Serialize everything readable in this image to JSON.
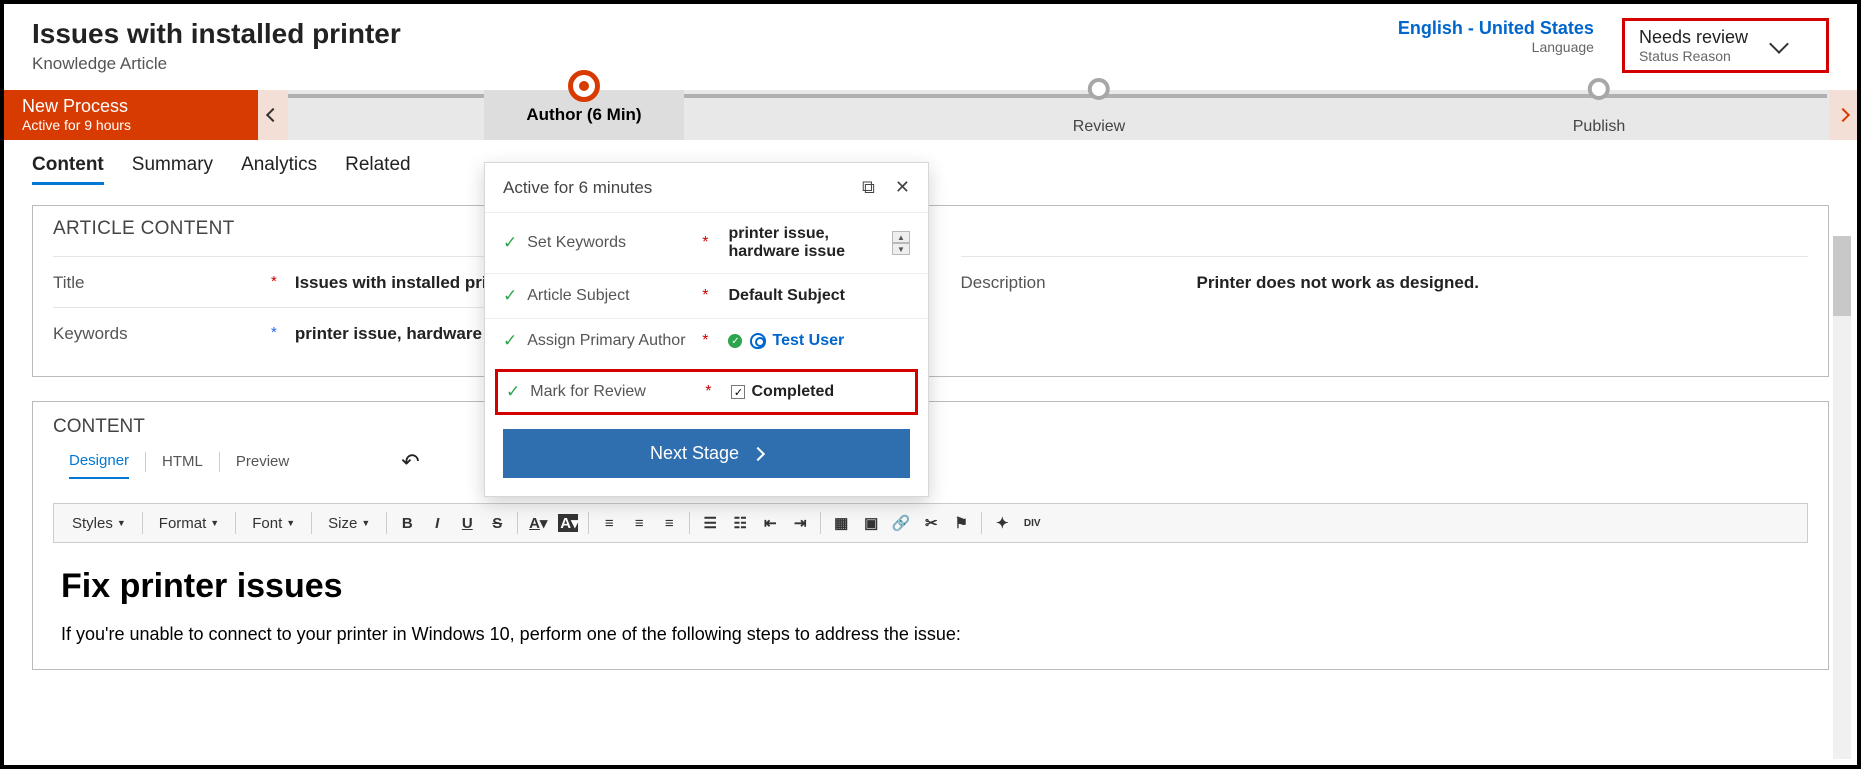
{
  "header": {
    "title": "Issues with installed printer",
    "subtitle": "Knowledge Article",
    "language": "English - United States",
    "language_label": "Language",
    "status": "Needs review",
    "status_label": "Status Reason"
  },
  "process": {
    "name": "New Process",
    "active": "Active for 9 hours",
    "stages": {
      "author": "Author  (6 Min)",
      "review": "Review",
      "publish": "Publish"
    }
  },
  "tabs": [
    "Content",
    "Summary",
    "Analytics",
    "Related"
  ],
  "article_panel": {
    "heading": "ARTICLE CONTENT",
    "fields": {
      "title_label": "Title",
      "title_value": "Issues with installed printer",
      "description_label": "Description",
      "description_value": "Printer does not work as designed.",
      "keywords_label": "Keywords",
      "keywords_value": "printer issue, hardware issue"
    }
  },
  "content_section": {
    "heading": "CONTENT",
    "tabs": {
      "designer": "Designer",
      "html": "HTML",
      "preview": "Preview"
    },
    "toolbar": {
      "styles": "Styles",
      "format": "Format",
      "font": "Font",
      "size": "Size"
    },
    "body_h": "Fix printer issues",
    "body_p": "If you're unable to connect to your printer in Windows 10, perform one of the following steps to address the issue:"
  },
  "popover": {
    "title": "Active for 6 minutes",
    "rows": {
      "keywords_label": "Set Keywords",
      "keywords_value": "printer issue, hardware issue",
      "subject_label": "Article Subject",
      "subject_value": "Default Subject",
      "author_label": "Assign Primary Author",
      "author_value": "Test User",
      "mark_label": "Mark for Review",
      "mark_value": "Completed"
    },
    "button": "Next Stage"
  }
}
